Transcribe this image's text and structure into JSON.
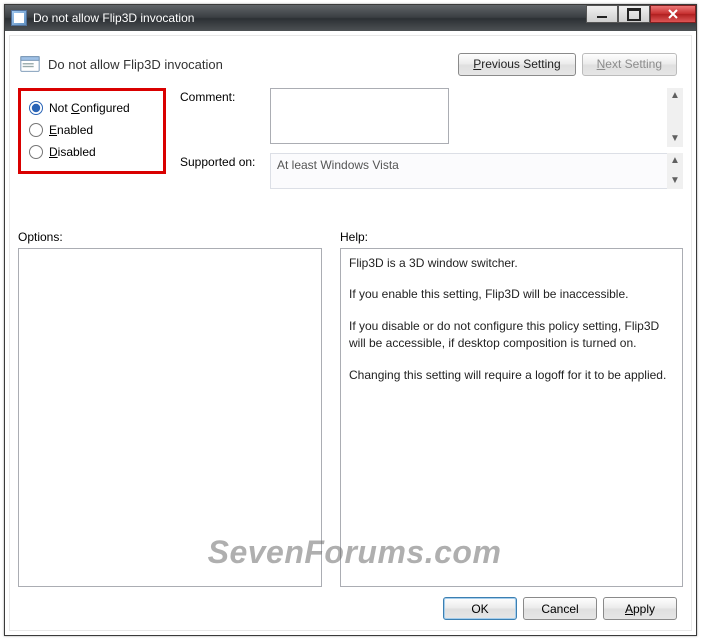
{
  "window": {
    "title": "Do not allow Flip3D invocation"
  },
  "header": {
    "policy_title": "Do not allow Flip3D invocation",
    "prev_label": "Previous Setting",
    "next_label": "Next Setting"
  },
  "radios": {
    "not_configured": "Not Configured",
    "enabled": "Enabled",
    "disabled": "Disabled",
    "selected": "not_configured"
  },
  "fields": {
    "comment_label": "Comment:",
    "comment_value": "",
    "supported_label": "Supported on:",
    "supported_value": "At least Windows Vista"
  },
  "panels": {
    "options_label": "Options:",
    "help_label": "Help:",
    "help_p1": "Flip3D is a 3D window switcher.",
    "help_p2": "If you enable this setting, Flip3D will be inaccessible.",
    "help_p3": "If you disable or do not configure this policy setting, Flip3D will be accessible, if desktop composition is turned on.",
    "help_p4": "Changing this setting will require a logoff for it to be applied."
  },
  "buttons": {
    "ok": "OK",
    "cancel": "Cancel",
    "apply": "Apply"
  },
  "watermark": "SevenForums.com",
  "highlight_color": "#d90000"
}
